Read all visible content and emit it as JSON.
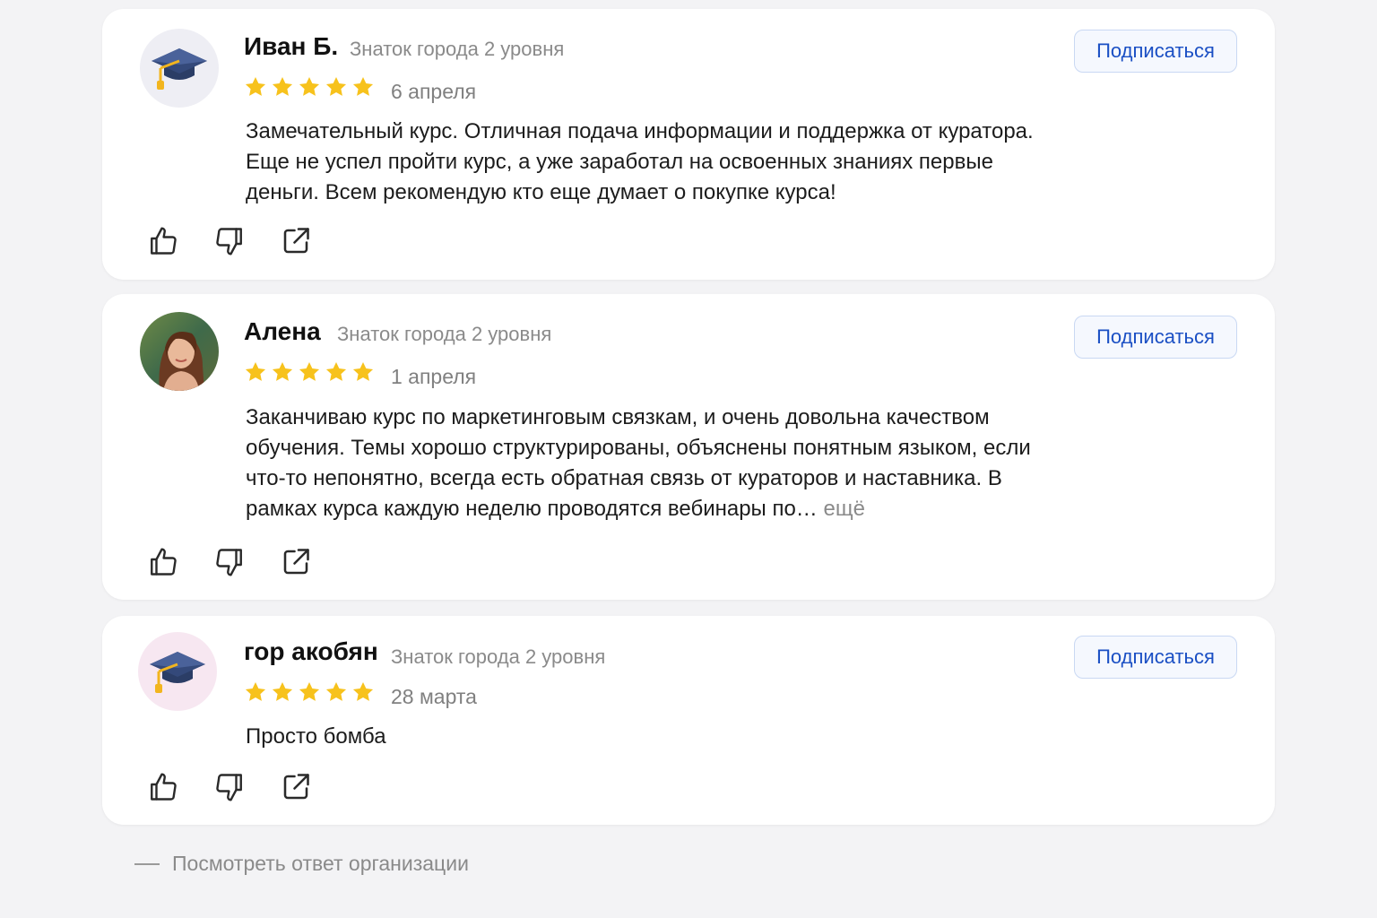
{
  "reviews": [
    {
      "author": "Иван Б.",
      "level": "Знаток города 2 уровня",
      "rating": 5,
      "date": "6 апреля",
      "text": "Замечательный курс. Отличная подача информации и поддержка от куратора. Еще не успел пройти курс, а уже заработал на освоенных знаниях первые деньги. Всем рекомендую кто еще думает о покупке курса!",
      "more": "",
      "subscribe_label": "Подписаться",
      "avatar": "graduation-cap-icon"
    },
    {
      "author": "Алена",
      "level": "Знаток города 2 уровня",
      "rating": 5,
      "date": "1 апреля",
      "text": "Заканчиваю курс по маркетинговым связкам, и очень довольна качеством обучения. Темы хорошо структурированы, объяснены понятным языком, если что-то непонятно, всегда есть обратная связь от кураторов и наставника. В рамках курса каждую неделю проводятся вебинары по…",
      "more": "ещё",
      "subscribe_label": "Подписаться",
      "avatar": "user-photo"
    },
    {
      "author": "гор акобян",
      "level": "Знаток города 2 уровня",
      "rating": 5,
      "date": "28 марта",
      "text": "Просто бомба",
      "more": "",
      "subscribe_label": "Подписаться",
      "avatar": "graduation-cap-icon"
    }
  ],
  "actions": [
    "thumbs-up-icon",
    "thumbs-down-icon",
    "share-icon"
  ],
  "footer": {
    "org_reply_label": "Посмотреть ответ организации"
  },
  "colors": {
    "page_background": "#f3f3f5",
    "card_background": "#ffffff",
    "star": "#f7c21c",
    "subscribe_text": "#1a4fc4",
    "subscribe_border": "#c9d8f3",
    "muted_text": "#8a8a8a"
  }
}
